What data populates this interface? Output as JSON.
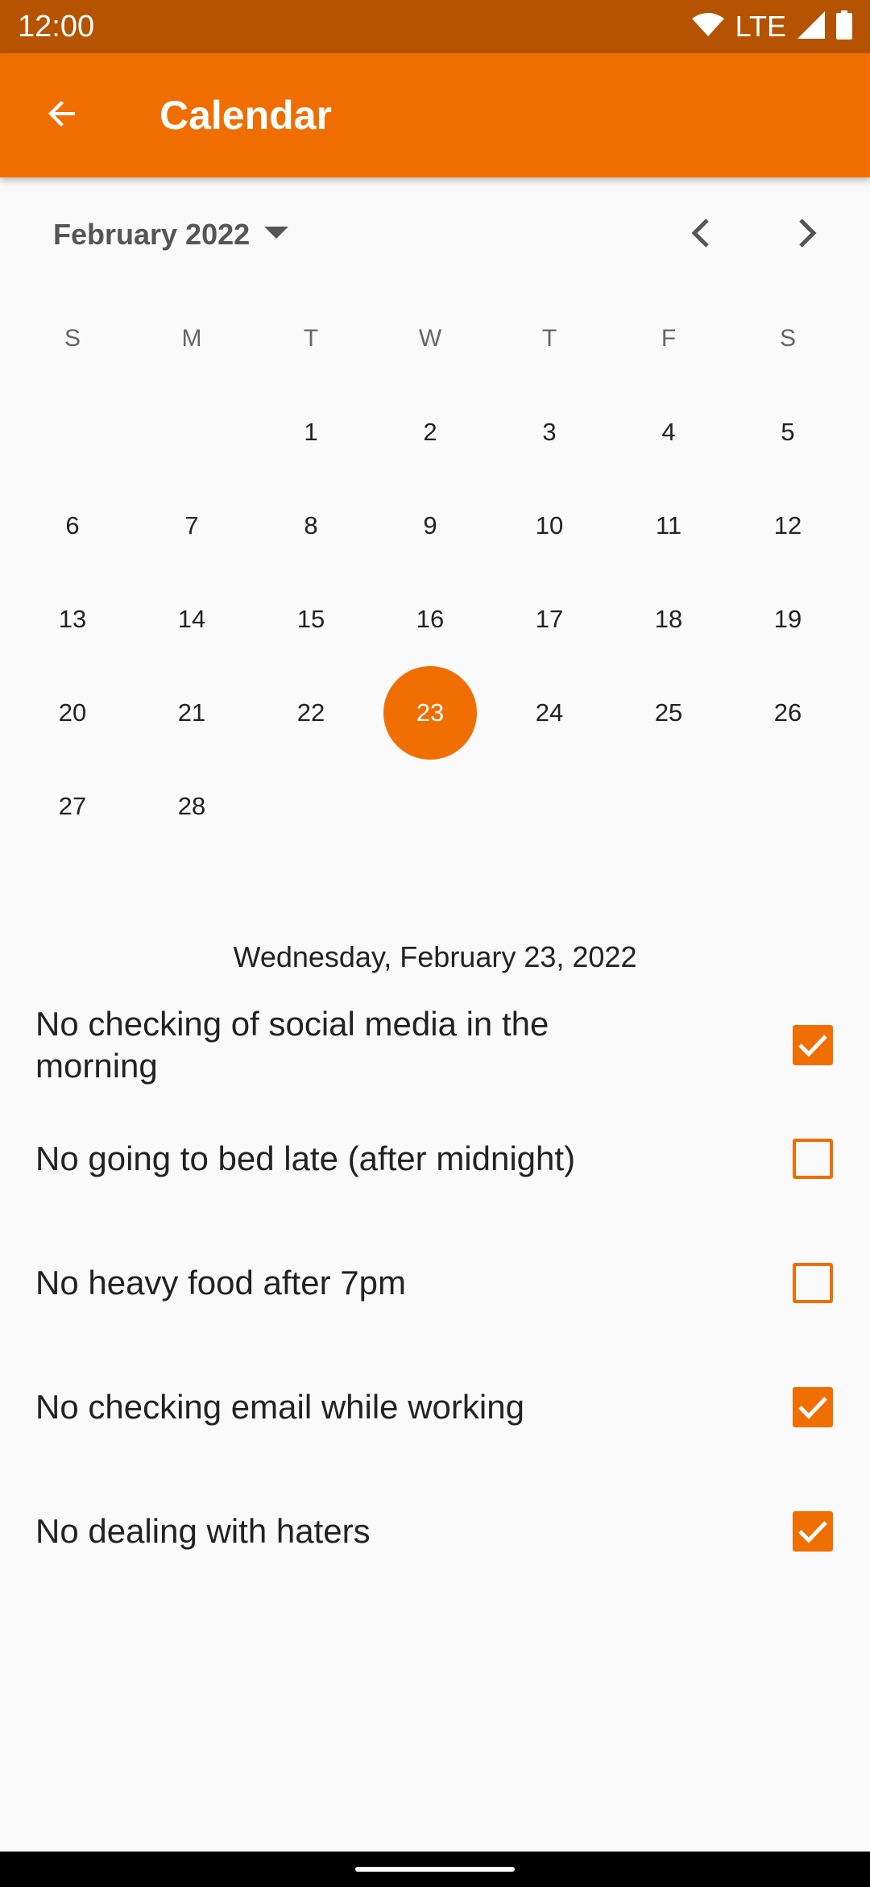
{
  "status_bar": {
    "time": "12:00",
    "network": "LTE"
  },
  "app_bar": {
    "title": "Calendar"
  },
  "calendar": {
    "month_label": "February 2022",
    "weekdays": [
      "S",
      "M",
      "T",
      "W",
      "T",
      "F",
      "S"
    ],
    "days": [
      "",
      "",
      "1",
      "2",
      "3",
      "4",
      "5",
      "6",
      "7",
      "8",
      "9",
      "10",
      "11",
      "12",
      "13",
      "14",
      "15",
      "16",
      "17",
      "18",
      "19",
      "20",
      "21",
      "22",
      "23",
      "24",
      "25",
      "26",
      "27",
      "28"
    ],
    "selected_day": "23",
    "accent_color": "#f06e00"
  },
  "selected_date_label": "Wednesday, February 23, 2022",
  "habits": [
    {
      "label": "No checking of social media in the morning",
      "checked": true
    },
    {
      "label": "No going to bed late (after midnight)",
      "checked": false
    },
    {
      "label": "No heavy food after 7pm",
      "checked": false
    },
    {
      "label": "No checking email while working",
      "checked": true
    },
    {
      "label": "No dealing with haters",
      "checked": true
    }
  ]
}
